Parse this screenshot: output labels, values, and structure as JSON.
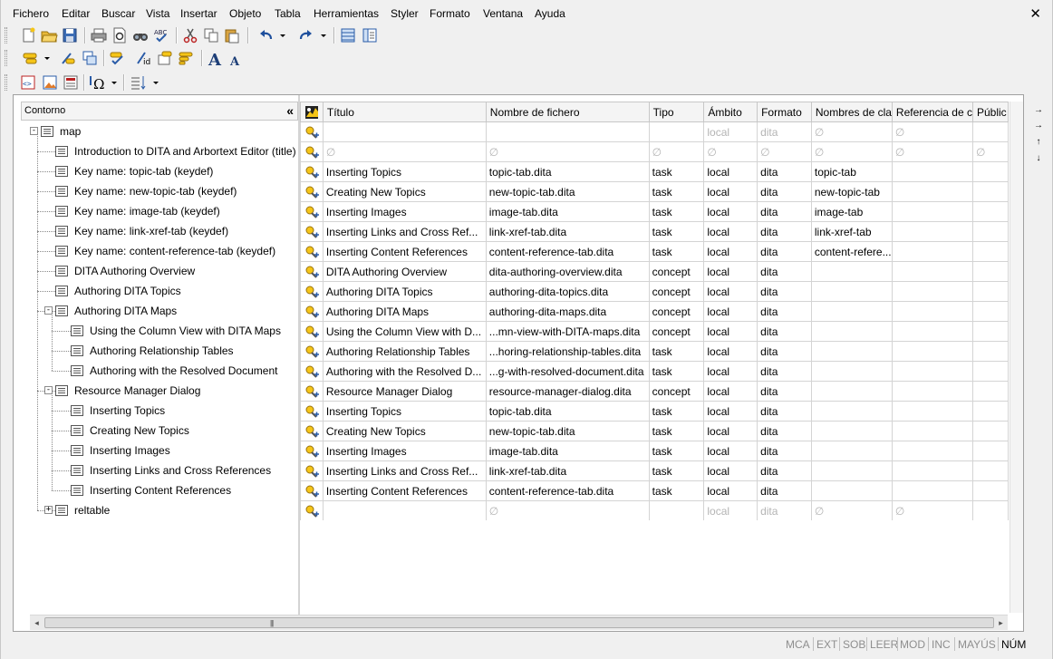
{
  "menu": [
    "Fichero",
    "Editar",
    "Buscar",
    "Vista",
    "Insertar",
    "Objeto",
    "Tabla",
    "Herramientas",
    "Styler",
    "Formato",
    "Ventana",
    "Ayuda"
  ],
  "window": {
    "close_glyph": "✕"
  },
  "toolbar_icons": {
    "row1": [
      "new-document-icon",
      "open-folder-icon",
      "save-icon",
      "print-icon",
      "print-preview-icon",
      "find-icon",
      "spell-check-icon",
      "cut-icon",
      "copy-icon",
      "paste-icon",
      "undo-icon",
      "redo-icon",
      "tag-view-icon",
      "document-map-icon"
    ],
    "row2": [
      "insert-markup-icon",
      "change-markup-icon",
      "split-icon",
      "check-completeness-icon",
      "edit-id-icon",
      "insert-reference-icon",
      "styler-icon",
      "increase-font-icon",
      "decrease-font-icon"
    ],
    "row3": [
      "xml-tag-icon",
      "insert-image-icon",
      "entity-icon",
      "special-character-icon",
      "sort-icon"
    ]
  },
  "toolbar_glyphs": {
    "font_large": "A",
    "font_small": "A",
    "omega": "Ω"
  },
  "outline": {
    "header": "Contorno",
    "collapse_glyph": "«"
  },
  "columns": [
    "Título",
    "Nombre de fichero",
    "Tipo",
    "Ámbito",
    "Formato",
    "Nombres de cla",
    "Referencia de c",
    "Públic"
  ],
  "null_glyph": "∅",
  "tree": [
    {
      "label": "map",
      "level": 0,
      "expander": "minus"
    },
    {
      "label": "Introduction to DITA and Arbortext Editor (title)",
      "level": 1,
      "expander": ""
    },
    {
      "label": "Key name: topic-tab (keydef)",
      "level": 1,
      "expander": ""
    },
    {
      "label": "Key name: new-topic-tab (keydef)",
      "level": 1,
      "expander": ""
    },
    {
      "label": "Key name: image-tab (keydef)",
      "level": 1,
      "expander": ""
    },
    {
      "label": "Key name: link-xref-tab (keydef)",
      "level": 1,
      "expander": ""
    },
    {
      "label": "Key name: content-reference-tab (keydef)",
      "level": 1,
      "expander": ""
    },
    {
      "label": "DITA Authoring Overview",
      "level": 1,
      "expander": ""
    },
    {
      "label": "Authoring DITA Topics",
      "level": 1,
      "expander": ""
    },
    {
      "label": "Authoring DITA Maps",
      "level": 1,
      "expander": "minus"
    },
    {
      "label": "Using the Column View with DITA Maps",
      "level": 2,
      "expander": ""
    },
    {
      "label": "Authoring Relationship Tables",
      "level": 2,
      "expander": ""
    },
    {
      "label": "Authoring with the Resolved Document",
      "level": 2,
      "expander": ""
    },
    {
      "label": "Resource Manager Dialog",
      "level": 1,
      "expander": "minus"
    },
    {
      "label": "Inserting Topics",
      "level": 2,
      "expander": ""
    },
    {
      "label": "Creating New Topics",
      "level": 2,
      "expander": ""
    },
    {
      "label": "Inserting Images",
      "level": 2,
      "expander": ""
    },
    {
      "label": "Inserting Links and Cross References",
      "level": 2,
      "expander": ""
    },
    {
      "label": "Inserting Content References",
      "level": 2,
      "expander": ""
    },
    {
      "label": "reltable",
      "level": 1,
      "expander": "plus"
    }
  ],
  "rows": [
    {
      "titulo": "",
      "fichero": "",
      "tipo": "",
      "ambito": "local",
      "formato": "dita",
      "claves": "∅",
      "referencia": "∅",
      "publico": "",
      "muted": true
    },
    {
      "titulo": "∅",
      "fichero": "∅",
      "tipo": "∅",
      "ambito": "∅",
      "formato": "∅",
      "claves": "∅",
      "referencia": "∅",
      "publico": "∅",
      "muted": true
    },
    {
      "titulo": "Inserting Topics",
      "fichero": "topic-tab.dita",
      "tipo": "task",
      "ambito": "local",
      "formato": "dita",
      "claves": "topic-tab",
      "referencia": "",
      "publico": ""
    },
    {
      "titulo": "Creating New Topics",
      "fichero": "new-topic-tab.dita",
      "tipo": "task",
      "ambito": "local",
      "formato": "dita",
      "claves": "new-topic-tab",
      "referencia": "",
      "publico": ""
    },
    {
      "titulo": "Inserting Images",
      "fichero": "image-tab.dita",
      "tipo": "task",
      "ambito": "local",
      "formato": "dita",
      "claves": "image-tab",
      "referencia": "",
      "publico": ""
    },
    {
      "titulo": "Inserting Links and Cross Ref...",
      "fichero": "link-xref-tab.dita",
      "tipo": "task",
      "ambito": "local",
      "formato": "dita",
      "claves": "link-xref-tab",
      "referencia": "",
      "publico": ""
    },
    {
      "titulo": "Inserting Content References",
      "fichero": "content-reference-tab.dita",
      "tipo": "task",
      "ambito": "local",
      "formato": "dita",
      "claves": "content-refere...",
      "referencia": "",
      "publico": ""
    },
    {
      "titulo": "DITA Authoring Overview",
      "fichero": "dita-authoring-overview.dita",
      "tipo": "concept",
      "ambito": "local",
      "formato": "dita",
      "claves": "",
      "referencia": "",
      "publico": ""
    },
    {
      "titulo": "Authoring DITA Topics",
      "fichero": "authoring-dita-topics.dita",
      "tipo": "concept",
      "ambito": "local",
      "formato": "dita",
      "claves": "",
      "referencia": "",
      "publico": ""
    },
    {
      "titulo": "Authoring DITA Maps",
      "fichero": "authoring-dita-maps.dita",
      "tipo": "concept",
      "ambito": "local",
      "formato": "dita",
      "claves": "",
      "referencia": "",
      "publico": ""
    },
    {
      "titulo": "Using the Column View with D...",
      "fichero": "...mn-view-with-DITA-maps.dita",
      "tipo": "concept",
      "ambito": "local",
      "formato": "dita",
      "claves": "",
      "referencia": "",
      "publico": ""
    },
    {
      "titulo": "Authoring Relationship Tables",
      "fichero": "...horing-relationship-tables.dita",
      "tipo": "task",
      "ambito": "local",
      "formato": "dita",
      "claves": "",
      "referencia": "",
      "publico": ""
    },
    {
      "titulo": "Authoring with the Resolved D...",
      "fichero": "...g-with-resolved-document.dita",
      "tipo": "task",
      "ambito": "local",
      "formato": "dita",
      "claves": "",
      "referencia": "",
      "publico": ""
    },
    {
      "titulo": "Resource Manager Dialog",
      "fichero": "resource-manager-dialog.dita",
      "tipo": "concept",
      "ambito": "local",
      "formato": "dita",
      "claves": "",
      "referencia": "",
      "publico": ""
    },
    {
      "titulo": "Inserting Topics",
      "fichero": "topic-tab.dita",
      "tipo": "task",
      "ambito": "local",
      "formato": "dita",
      "claves": "",
      "referencia": "",
      "publico": ""
    },
    {
      "titulo": "Creating New Topics",
      "fichero": "new-topic-tab.dita",
      "tipo": "task",
      "ambito": "local",
      "formato": "dita",
      "claves": "",
      "referencia": "",
      "publico": ""
    },
    {
      "titulo": "Inserting Images",
      "fichero": "image-tab.dita",
      "tipo": "task",
      "ambito": "local",
      "formato": "dita",
      "claves": "",
      "referencia": "",
      "publico": ""
    },
    {
      "titulo": "Inserting Links and Cross Ref...",
      "fichero": "link-xref-tab.dita",
      "tipo": "task",
      "ambito": "local",
      "formato": "dita",
      "claves": "",
      "referencia": "",
      "publico": ""
    },
    {
      "titulo": "Inserting Content References",
      "fichero": "content-reference-tab.dita",
      "tipo": "task",
      "ambito": "local",
      "formato": "dita",
      "claves": "",
      "referencia": "",
      "publico": ""
    },
    {
      "titulo": "",
      "fichero": "∅",
      "tipo": "",
      "ambito": "local",
      "formato": "dita",
      "claves": "∅",
      "referencia": "∅",
      "publico": "",
      "muted": true
    }
  ],
  "side_arrows": [
    "→",
    "→",
    "↑",
    "↓"
  ],
  "scrollbar": {
    "left": "◂",
    "right": "▸",
    "grip": "|||"
  },
  "status": [
    {
      "label": "MCA",
      "active": false
    },
    {
      "label": "EXT",
      "active": false
    },
    {
      "label": "SOB",
      "active": false
    },
    {
      "label": "LEER",
      "active": false
    },
    {
      "label": "MOD",
      "active": false
    },
    {
      "label": "INC",
      "active": false
    },
    {
      "label": "MAYÚS",
      "active": false
    },
    {
      "label": "NÚM",
      "active": true
    }
  ],
  "colors": {
    "accent_yellow": "#f5c518",
    "icon_blue": "#2a5ca8",
    "grid_border": "#d4d4d4"
  }
}
